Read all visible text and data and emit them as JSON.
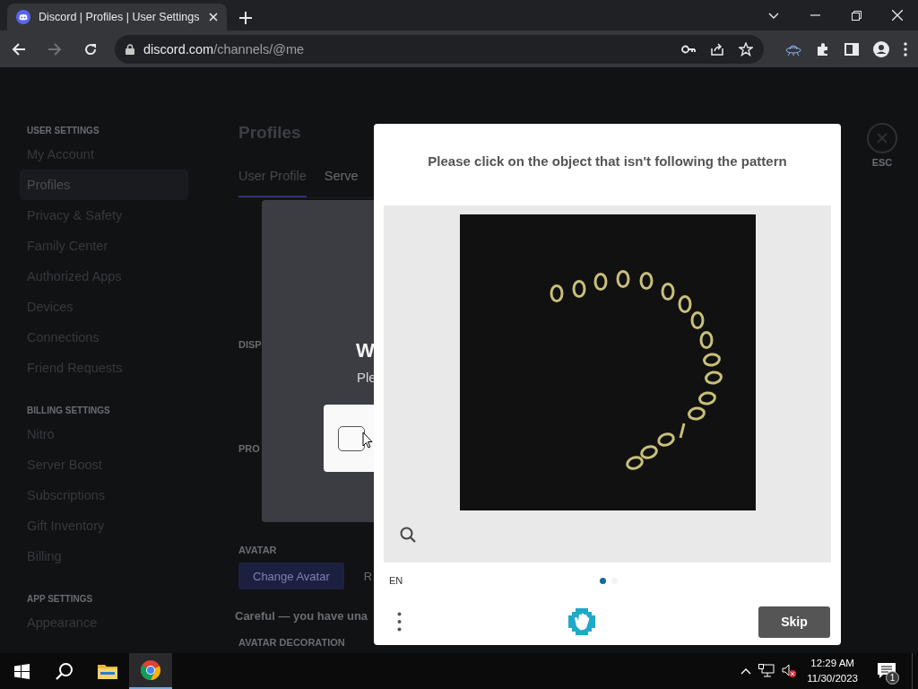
{
  "browser": {
    "tab_title": "Discord | Profiles | User Settings",
    "url_host": "discord.com",
    "url_path": "/channels/@me"
  },
  "sidebar": {
    "sections": [
      {
        "header": "USER SETTINGS",
        "items": [
          {
            "label": "My Account",
            "selected": false
          },
          {
            "label": "Profiles",
            "selected": true
          },
          {
            "label": "Privacy & Safety",
            "selected": false
          },
          {
            "label": "Family Center",
            "selected": false
          },
          {
            "label": "Authorized Apps",
            "selected": false
          },
          {
            "label": "Devices",
            "selected": false
          },
          {
            "label": "Connections",
            "selected": false
          },
          {
            "label": "Friend Requests",
            "selected": false
          }
        ]
      },
      {
        "header": "BILLING SETTINGS",
        "items": [
          {
            "label": "Nitro",
            "selected": false
          },
          {
            "label": "Server Boost",
            "selected": false
          },
          {
            "label": "Subscriptions",
            "selected": false
          },
          {
            "label": "Gift Inventory",
            "selected": false
          },
          {
            "label": "Billing",
            "selected": false
          }
        ]
      },
      {
        "header": "APP SETTINGS",
        "items": [
          {
            "label": "Appearance",
            "selected": false
          }
        ]
      }
    ]
  },
  "main": {
    "title": "Profiles",
    "tabs": [
      {
        "label": "User Profile",
        "selected": true
      },
      {
        "label": "Serve",
        "selected": false
      }
    ],
    "labels": [
      "DISP",
      "PRO"
    ],
    "avatar_label": "AVATAR",
    "change_avatar": "Change Avatar",
    "remove_cut": "R",
    "notice": "Careful — you have una",
    "decoration_label": "AVATAR DECORATION",
    "esc": "ESC"
  },
  "verify_dialog": {
    "title": "W",
    "text": "Ple",
    "checkbox": {
      "checked": false
    }
  },
  "captcha": {
    "prompt": "Please click on the object that isn't following the pattern",
    "language": "EN",
    "pages": [
      {
        "selected": true
      },
      {
        "selected": false
      }
    ],
    "skip": "Skip"
  },
  "taskbar": {
    "apps": [
      {
        "kind": "explorer",
        "selected": false
      },
      {
        "kind": "chrome",
        "selected": true
      }
    ],
    "time": "12:29 AM",
    "date": "11/30/2023",
    "notifications": "1"
  }
}
